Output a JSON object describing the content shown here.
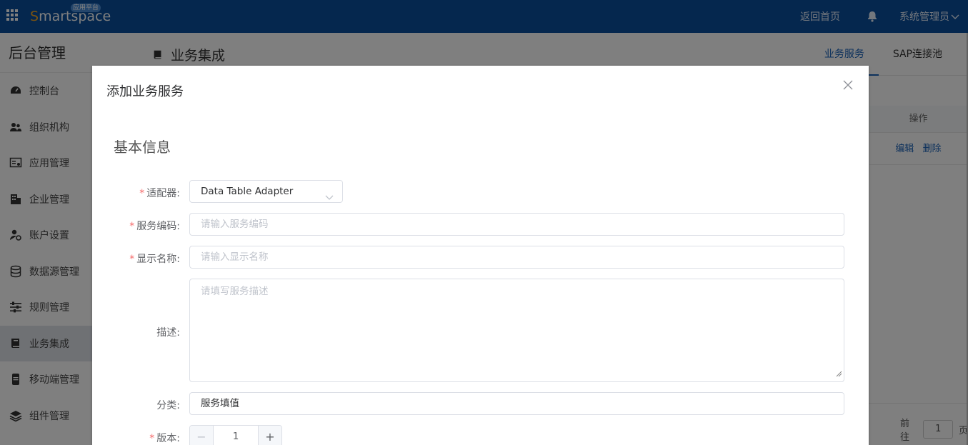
{
  "header": {
    "logo_text": "Smartspace",
    "logo_badge": "应用平台",
    "home_link": "返回首页",
    "user_name": "系统管理员"
  },
  "sidebar": {
    "title": "后台管理",
    "items": [
      {
        "label": "控制台",
        "icon": "dashboard-icon"
      },
      {
        "label": "组织机构",
        "icon": "users-icon"
      },
      {
        "label": "应用管理",
        "icon": "app-settings-icon"
      },
      {
        "label": "企业管理",
        "icon": "building-icon"
      },
      {
        "label": "账户设置",
        "icon": "user-gear-icon"
      },
      {
        "label": "数据源管理",
        "icon": "database-icon"
      },
      {
        "label": "规则管理",
        "icon": "sliders-icon"
      },
      {
        "label": "业务集成",
        "icon": "book-icon",
        "active": true
      },
      {
        "label": "移动端管理",
        "icon": "mobile-icon"
      },
      {
        "label": "组件管理",
        "icon": "layers-icon"
      }
    ]
  },
  "main": {
    "title": "业务集成",
    "tabs": [
      "业务服务",
      "SAP连接池"
    ],
    "table_header_ops": "操作",
    "row_edit": "编辑",
    "row_delete": "删除",
    "pager_goto": "前往",
    "pager_page": "1",
    "pager_suffix": "页"
  },
  "modal": {
    "title": "添加业务服务",
    "section_title": "基本信息",
    "fields": {
      "adapter": {
        "label": "适配器:",
        "value": "Data Table Adapter",
        "required": true
      },
      "service_code": {
        "label": "服务编码:",
        "placeholder": "请输入服务编码",
        "required": true
      },
      "display_name": {
        "label": "显示名称:",
        "placeholder": "请输入显示名称",
        "required": true
      },
      "description": {
        "label": "描述:",
        "placeholder": "请填写服务描述"
      },
      "category": {
        "label": "分类:",
        "value": "服务填值"
      },
      "version": {
        "label": "版本:",
        "value": "1",
        "required": true
      }
    },
    "required_mark": "*"
  }
}
